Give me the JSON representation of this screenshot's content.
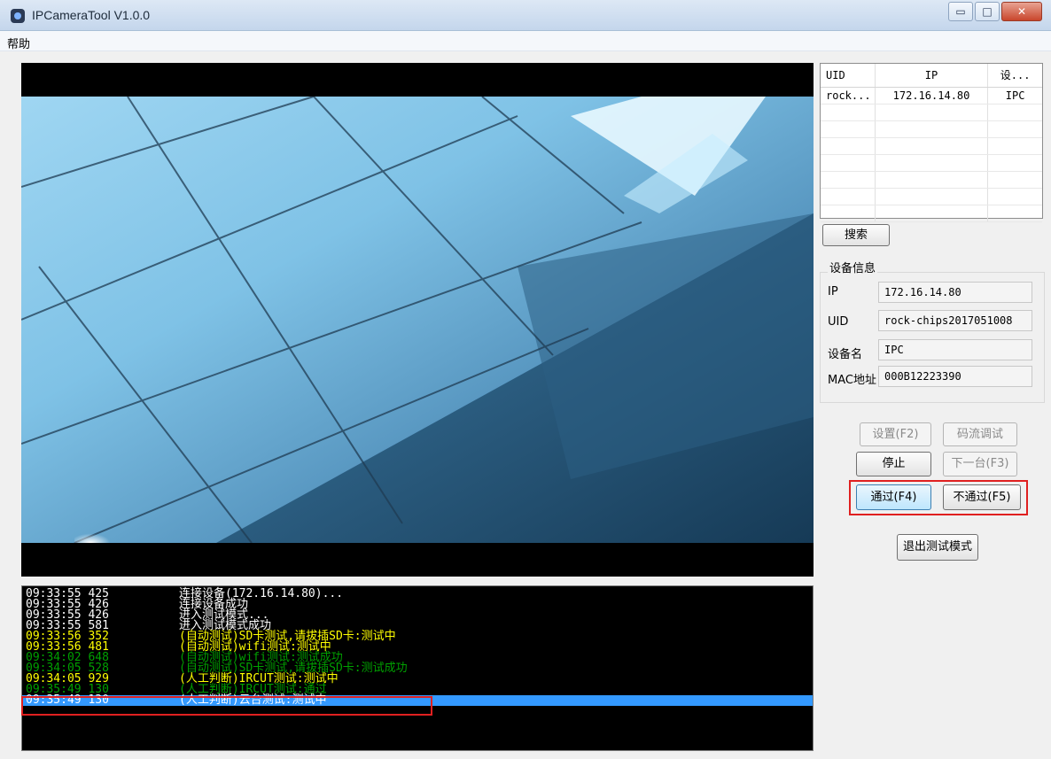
{
  "window": {
    "title": "IPCameraTool V1.0.0",
    "minimize": "▭",
    "maximize": "□",
    "close": "✕"
  },
  "menu": {
    "help": "帮助"
  },
  "device_table": {
    "headers": [
      "UID",
      "IP",
      "设..."
    ],
    "rows": [
      [
        "rock...",
        "172.16.14.80",
        "IPC"
      ]
    ]
  },
  "search_button": "搜索",
  "device_info": {
    "title": "设备信息",
    "ip_label": "IP",
    "ip_value": "172.16.14.80",
    "uid_label": "UID",
    "uid_value": "rock-chips2017051008",
    "name_label": "设备名",
    "name_value": "IPC",
    "mac_label": "MAC地址",
    "mac_value": "000B12223390"
  },
  "buttons": {
    "settings": "设置(F2)",
    "stream_debug": "码流调试",
    "stop": "停止",
    "next": "下一台(F3)",
    "pass": "通过(F4)",
    "fail": "不通过(F5)",
    "exit_test": "退出测试模式"
  },
  "log": [
    {
      "time": "09:33:55 425",
      "msg": "连接设备(172.16.14.80)...",
      "color": "#ffffff"
    },
    {
      "time": "09:33:55 426",
      "msg": "连接设备成功",
      "color": "#ffffff"
    },
    {
      "time": "09:33:55 426",
      "msg": "进入测试模式...",
      "color": "#ffffff"
    },
    {
      "time": "09:33:55 581",
      "msg": "进入测试模式成功",
      "color": "#ffffff"
    },
    {
      "time": "09:33:56 352",
      "msg": "(自动测试)SD卡测试,请拔插SD卡:测试中",
      "color": "#ffff00"
    },
    {
      "time": "09:33:56 481",
      "msg": "(自动测试)wifi测试:测试中",
      "color": "#ffff00"
    },
    {
      "time": "09:34:02 648",
      "msg": "(自动测试)wifi测试:测试成功",
      "color": "#00a000"
    },
    {
      "time": "09:34:05 528",
      "msg": "(自动测试)SD卡测试,请拔插SD卡:测试成功",
      "color": "#00a000"
    },
    {
      "time": "09:34:05 929",
      "msg": "(人工判断)IRCUT测试:测试中",
      "color": "#ffff00"
    },
    {
      "time": "09:35:49 130",
      "msg": "(人工判断)IRCUT测试:通过",
      "color": "#00a000"
    },
    {
      "time": "09:35:49 130",
      "msg": "(人工判断)云台测试:测试中",
      "color": "#ffffff",
      "selected": true
    }
  ]
}
